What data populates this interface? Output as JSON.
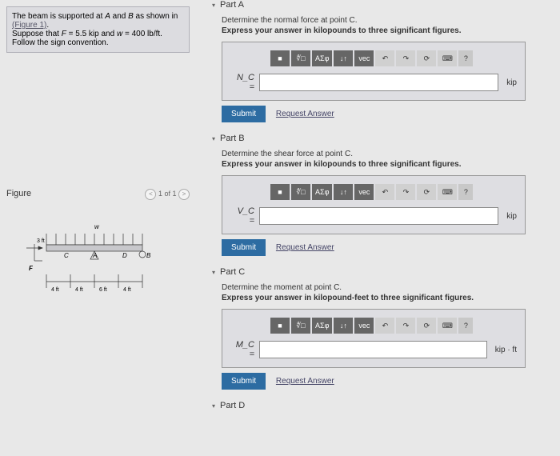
{
  "problem": {
    "line1_a": "The beam is supported at ",
    "line1_b": " and ",
    "line1_c": " as shown in ",
    "fig_link": "(Figure 1)",
    "line2_a": "Suppose that ",
    "line2_b": " = 5.5 kip and ",
    "line2_c": " = 400 lb/ft. Follow the sign convention."
  },
  "figure": {
    "title": "Figure",
    "nav": "1 of 1"
  },
  "toolbar": {
    "tmpl": "■",
    "sqrt": "∜□",
    "greek": "ΑΣφ",
    "arrows": "↓↑",
    "vec": "vec",
    "undo": "↶",
    "redo": "↷",
    "reset": "⟳",
    "kbd": "⌨",
    "help": "?"
  },
  "parts": {
    "a": {
      "header": "Part A",
      "prompt": "Determine the normal force at point C.",
      "instr": "Express your answer in kilopounds to three significant figures.",
      "var": "N_C =",
      "unit": "kip"
    },
    "b": {
      "header": "Part B",
      "prompt": "Determine the shear force at point C.",
      "instr": "Express your answer in kilopounds to three significant figures.",
      "var": "V_C =",
      "unit": "kip"
    },
    "c": {
      "header": "Part C",
      "prompt": "Determine the moment at point C.",
      "instr": "Express your answer in kilopound-feet to three significant figures.",
      "var": "M_C =",
      "unit": "kip · ft"
    },
    "d": {
      "header": "Part D"
    }
  },
  "buttons": {
    "submit": "Submit",
    "request": "Request Answer"
  }
}
